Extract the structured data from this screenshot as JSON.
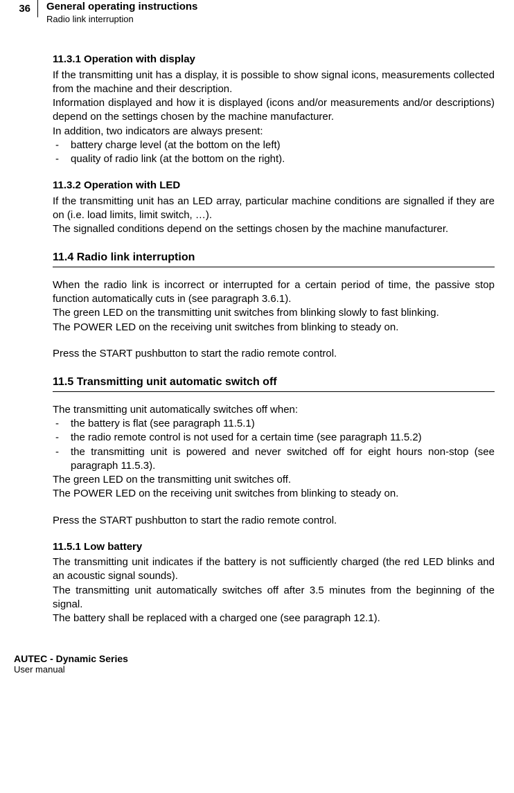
{
  "header": {
    "page_number": "36",
    "title": "General operating instructions",
    "subtitle": "Radio link interruption"
  },
  "s11_3_1": {
    "heading": "11.3.1 Operation with display",
    "p1": "If the transmitting unit has a display, it is possible to show signal icons, measurements collected from the machine and their description.",
    "p2": "Information displayed and how it is displayed (icons and/or measurements and/or descriptions) depend on the settings chosen by the machine manufacturer.",
    "p3": "In addition, two indicators are always present:",
    "bullets": [
      "battery charge level (at the bottom on the left)",
      "quality of radio link (at the bottom on the right)."
    ]
  },
  "s11_3_2": {
    "heading": "11.3.2 Operation with LED",
    "p1": "If the transmitting unit has an LED array, particular machine conditions are signalled if they are on (i.e. load limits, limit switch, …).",
    "p2": "The signalled conditions depend on the settings chosen by the machine manufacturer."
  },
  "s11_4": {
    "heading": "11.4 Radio link interruption",
    "p1": "When the radio link is incorrect or interrupted for a certain period of time, the passive stop function automatically cuts in (see paragraph 3.6.1).",
    "p2": "The green LED on the transmitting unit switches from blinking slowly to fast blinking.",
    "p3": "The POWER LED on the receiving unit switches from blinking to steady on.",
    "p4": "Press the START pushbutton to start the radio remote control."
  },
  "s11_5": {
    "heading": "11.5 Transmitting unit automatic switch off",
    "p1": "The transmitting unit automatically switches off when:",
    "bullets": [
      "the battery is flat (see paragraph 11.5.1)",
      "the radio remote control is not used for a certain time (see paragraph 11.5.2)",
      "the transmitting unit is powered and never switched off for eight hours non-stop (see paragraph 11.5.3)."
    ],
    "p2": "The green LED on the transmitting unit switches off.",
    "p3": "The POWER LED on the receiving unit switches from blinking to steady on.",
    "p4": "Press the START pushbutton to start the radio remote control."
  },
  "s11_5_1": {
    "heading": "11.5.1 Low battery",
    "p1": "The transmitting unit indicates if the battery is not sufficiently charged (the red LED blinks and an acoustic signal sounds).",
    "p2": "The transmitting unit automatically switches off after 3.5 minutes from the beginning of the signal.",
    "p3": "The battery shall be replaced with a charged one (see paragraph 12.1)."
  },
  "footer": {
    "title": "AUTEC - Dynamic Series",
    "sub": "User manual"
  }
}
